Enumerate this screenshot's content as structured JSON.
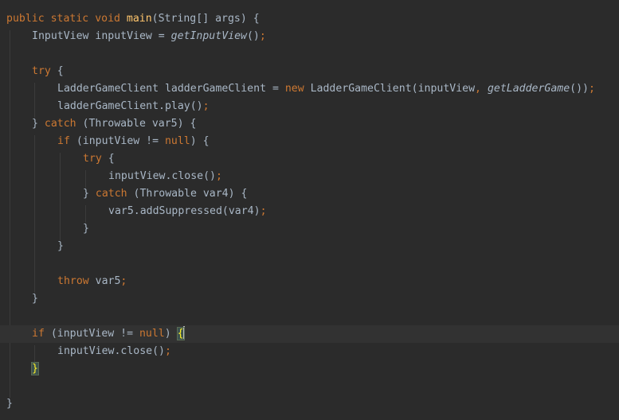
{
  "code": {
    "line01": {
      "kw1": "public",
      "kw2": "static",
      "kw3": "void",
      "fn": "main",
      "rest": "(String[] args) {"
    },
    "line02": {
      "a": "InputView inputView = ",
      "call": "getInputView",
      "b": "()",
      "semi": ";"
    },
    "line04": {
      "kw": "try",
      "rest": " {"
    },
    "line05": {
      "a": "LadderGameClient ladderGameClient = ",
      "kw": "new",
      "b": " LadderGameClient(inputView",
      "comma": ",",
      "c": " ",
      "call": "getLadderGame",
      "d": "())",
      "semi": ";"
    },
    "line06": {
      "a": "ladderGameClient.play()",
      "semi": ";"
    },
    "line07": {
      "a": "} ",
      "kw": "catch",
      "b": " (Throwable var5) {"
    },
    "line08": {
      "kw": "if",
      "a": " (inputView != ",
      "kw2": "null",
      "b": ") {"
    },
    "line09": {
      "kw": "try",
      "rest": " {"
    },
    "line10": {
      "a": "inputView.close()",
      "semi": ";"
    },
    "line11": {
      "a": "} ",
      "kw": "catch",
      "b": " (Throwable var4) {"
    },
    "line12": {
      "a": "var5.addSuppressed(var4)",
      "semi": ";"
    },
    "line13": {
      "a": "}"
    },
    "line14": {
      "a": "}"
    },
    "line16": {
      "kw": "throw",
      "a": " var5",
      "semi": ";"
    },
    "line17": {
      "a": "}"
    },
    "line19": {
      "kw": "if",
      "a": " (inputView != ",
      "kw2": "null",
      "b": ") ",
      "brace": "{"
    },
    "line20": {
      "a": "inputView.close()",
      "semi": ";"
    },
    "line21": {
      "brace": "}"
    },
    "line23": {
      "a": "}"
    }
  },
  "colors": {
    "background": "#2b2b2b",
    "current_line": "#323232",
    "keyword": "#cc7832",
    "function_decl": "#ffc66d",
    "default_text": "#a9b7c6",
    "brace_match": "#ffef28"
  }
}
